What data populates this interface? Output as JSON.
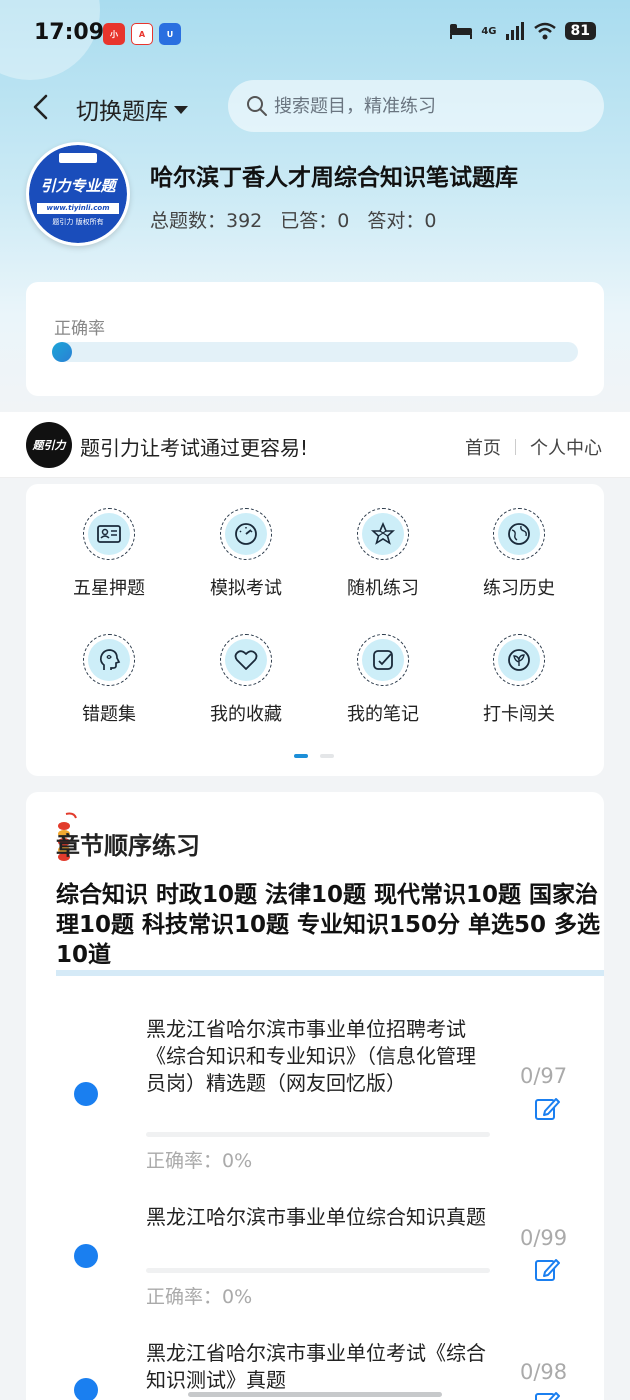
{
  "status_bar": {
    "time": "17:09",
    "battery": "81",
    "network": "4G"
  },
  "header": {
    "switch_label": "切换题库",
    "search_placeholder": "搜索题目，精准练习"
  },
  "bank": {
    "logo_text": "引力专业题",
    "logo_url": "www.tiyinli.com",
    "logo_sub": "题引力 版权所有",
    "title": "哈尔滨丁香人才周综合知识笔试题库",
    "total_label": "总题数：392",
    "answered_label": "已答：0",
    "correct_label": "答对：0"
  },
  "accuracy": {
    "label": "正确率",
    "value": 0
  },
  "banner": {
    "logo_text": "题引力",
    "slogan": "题引力让考试通过更容易!",
    "nav_home": "首页",
    "nav_profile": "个人中心"
  },
  "grid": {
    "items": [
      {
        "label": "五星押题",
        "icon": "id-card-icon"
      },
      {
        "label": "模拟考试",
        "icon": "speedometer-icon"
      },
      {
        "label": "随机练习",
        "icon": "star-network-icon"
      },
      {
        "label": "练习历史",
        "icon": "globe-icon"
      },
      {
        "label": "错题集",
        "icon": "head-profile-icon"
      },
      {
        "label": "我的收藏",
        "icon": "heart-icon"
      },
      {
        "label": "我的笔记",
        "icon": "note-check-icon"
      },
      {
        "label": "打卡闯关",
        "icon": "leaf-shield-icon"
      }
    ],
    "page": 1,
    "pages": 2
  },
  "chapter": {
    "title": "章节顺序练习",
    "description": "综合知识 时政10题 法律10题 现代常识10题 国家治理10题 科技常识10题 专业知识150分 单选50 多选10道",
    "items": [
      {
        "title": "黑龙江省哈尔滨市事业单位招聘考试《综合知识和专业知识》（信息化管理员岗）精选题（网友回忆版）",
        "accuracy": "正确率：0%",
        "count": "0/97"
      },
      {
        "title": "黑龙江哈尔滨市事业单位综合知识真题",
        "accuracy": "正确率：0%",
        "count": "0/99"
      },
      {
        "title": "黑龙江省哈尔滨市事业单位考试《综合知识测试》真题",
        "accuracy": "",
        "count": "0/98"
      }
    ]
  },
  "colors": {
    "accent": "#1a7ff0",
    "logo_blue": "#1a4dbb",
    "icon_bg": "#cdeef8"
  }
}
